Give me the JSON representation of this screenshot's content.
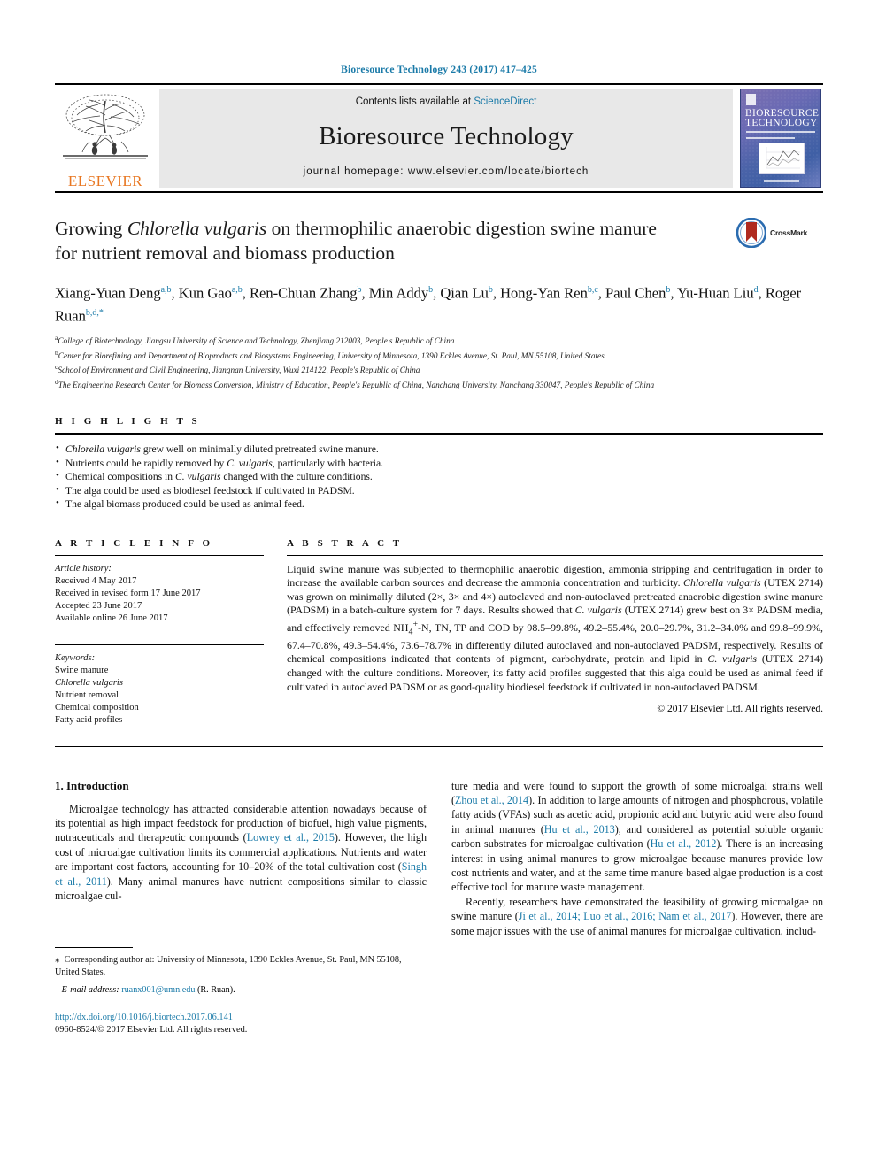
{
  "running_head": "Bioresource Technology 243 (2017) 417–425",
  "masthead": {
    "publisher_name": "ELSEVIER",
    "contents_prefix": "Contents lists available at ",
    "contents_link": "ScienceDirect",
    "journal_title": "Bioresource Technology",
    "homepage": "journal homepage: www.elsevier.com/locate/biortech",
    "cover_title_line1": "BIORESOURCE",
    "cover_title_line2": "TECHNOLOGY"
  },
  "article": {
    "title_part1": "Growing ",
    "title_italic": "Chlorella vulgaris",
    "title_part2": " on thermophilic anaerobic digestion swine manure for nutrient removal and biomass production",
    "crossmark_label": "CrossMark",
    "authors_html": "Xiang-Yuan Deng<sup>a,b</sup>, Kun Gao<sup>a,b</sup>, Ren-Chuan Zhang<sup>b</sup>, Min Addy<sup>b</sup>, Qian Lu<sup>b</sup>, Hong-Yan Ren<sup>b,c</sup>, Paul Chen<sup>b</sup>, Yu-Huan Liu<sup>d</sup>, Roger Ruan<sup>b,d,*</sup>",
    "affiliations": [
      {
        "marker": "a",
        "text": "College of Biotechnology, Jiangsu University of Science and Technology, Zhenjiang 212003, People's Republic of China"
      },
      {
        "marker": "b",
        "text": "Center for Biorefining and Department of Bioproducts and Biosystems Engineering, University of Minnesota, 1390 Eckles Avenue, St. Paul, MN 55108, United States"
      },
      {
        "marker": "c",
        "text": "School of Environment and Civil Engineering, Jiangnan University, Wuxi 214122, People's Republic of China"
      },
      {
        "marker": "d",
        "text": "The Engineering Research Center for Biomass Conversion, Ministry of Education, People's Republic of China, Nanchang University, Nanchang 330047, People's Republic of China"
      }
    ]
  },
  "highlights": {
    "heading": "H I G H L I G H T S",
    "items_html": [
      "<i>Chlorella vulgaris</i> grew well on minimally diluted pretreated swine manure.",
      "Nutrients could be rapidly removed by <i>C. vulgaris</i>, particularly with bacteria.",
      "Chemical compositions in <i>C. vulgaris</i> changed with the culture conditions.",
      "The alga could be used as biodiesel feedstock if cultivated in PADSM.",
      "The algal biomass produced could be used as animal feed."
    ]
  },
  "article_info": {
    "heading": "A R T I C L E   I N F O",
    "history_title": "Article history:",
    "history": [
      "Received 4 May 2017",
      "Received in revised form 17 June 2017",
      "Accepted 23 June 2017",
      "Available online 26 June 2017"
    ],
    "keywords_title": "Keywords:",
    "keywords_html": [
      "Swine manure",
      "<i>Chlorella vulgaris</i>",
      "Nutrient removal",
      "Chemical composition",
      "Fatty acid profiles"
    ]
  },
  "abstract": {
    "heading": "A B S T R A C T",
    "text_html": "Liquid swine manure was subjected to thermophilic anaerobic digestion, ammonia stripping and centrifugation in order to increase the available carbon sources and decrease the ammonia concentration and turbidity. <i>Chlorella vulgaris</i> (UTEX 2714) was grown on minimally diluted (2×, 3× and 4×) autoclaved and non-autoclaved pretreated anaerobic digestion swine manure (PADSM) in a batch-culture system for 7 days. Results showed that <i>C. vulgaris</i> (UTEX 2714) grew best on 3× PADSM media, and effectively removed NH<sub>4</sub><sup>+</sup>-N, TN, TP and COD by 98.5–99.8%, 49.2–55.4%, 20.0–29.7%, 31.2–34.0% and 99.8–99.9%, 67.4–70.8%, 49.3–54.4%, 73.6–78.7% in differently diluted autoclaved and non-autoclaved PADSM, respectively. Results of chemical compositions indicated that contents of pigment, carbohydrate, protein and lipid in <i>C. vulgaris</i> (UTEX 2714) changed with the culture conditions. Moreover, its fatty acid profiles suggested that this alga could be used as animal feed if cultivated in autoclaved PADSM or as good-quality biodiesel feedstock if cultivated in non-autoclaved PADSM.",
    "copyright": "© 2017 Elsevier Ltd. All rights reserved."
  },
  "introduction": {
    "heading": "1. Introduction",
    "left_paragraph_html": "Microalgae technology has attracted considerable attention nowadays because of its potential as high impact feedstock for production of biofuel, high value pigments, nutraceuticals and therapeutic compounds (<span class=\"cite\">Lowrey et al., 2015</span>). However, the high cost of microalgae cultivation limits its commercial applications. Nutrients and water are important cost factors, accounting for 10–20% of the total cultivation cost (<span class=\"cite\">Singh et al., 2011</span>). Many animal manures have nutrient compositions similar to classic microalgae cul-",
    "right_paragraph1_html": "ture media and were found to support the growth of some microalgal strains well (<span class=\"cite\">Zhou et al., 2014</span>). In addition to large amounts of nitrogen and phosphorous, volatile fatty acids (VFAs) such as acetic acid, propionic acid and butyric acid were also found in animal manures (<span class=\"cite\">Hu et al., 2013</span>), and considered as potential soluble organic carbon substrates for microalgae cultivation (<span class=\"cite\">Hu et al., 2012</span>). There is an increasing interest in using animal manures to grow microalgae because manures provide low cost nutrients and water, and at the same time manure based algae production is a cost effective tool for manure waste management.",
    "right_paragraph2_html": "Recently, researchers have demonstrated the feasibility of growing microalgae on swine manure (<span class=\"cite\">Ji et al., 2014; Luo et al., 2016; Nam et al., 2017</span>). However, there are some major issues with the use of animal manures for microalgae cultivation, includ-"
  },
  "footnotes": {
    "corresponding_html": "<span class=\"star\">⁎</span>&nbsp; Corresponding author at: University of Minnesota, 1390 Eckles Avenue, St. Paul, MN 55108, United States.",
    "email_label": "E-mail address:",
    "email_value": "ruanx001@umn.edu",
    "email_suffix": "(R. Ruan).",
    "doi": "http://dx.doi.org/10.1016/j.biortech.2017.06.141",
    "issn": "0960-8524/© 2017 Elsevier Ltd. All rights reserved."
  },
  "colors": {
    "link_blue": "#1a7aa8",
    "elsevier_orange": "#e87722",
    "band_gray": "#e8e8e8"
  }
}
